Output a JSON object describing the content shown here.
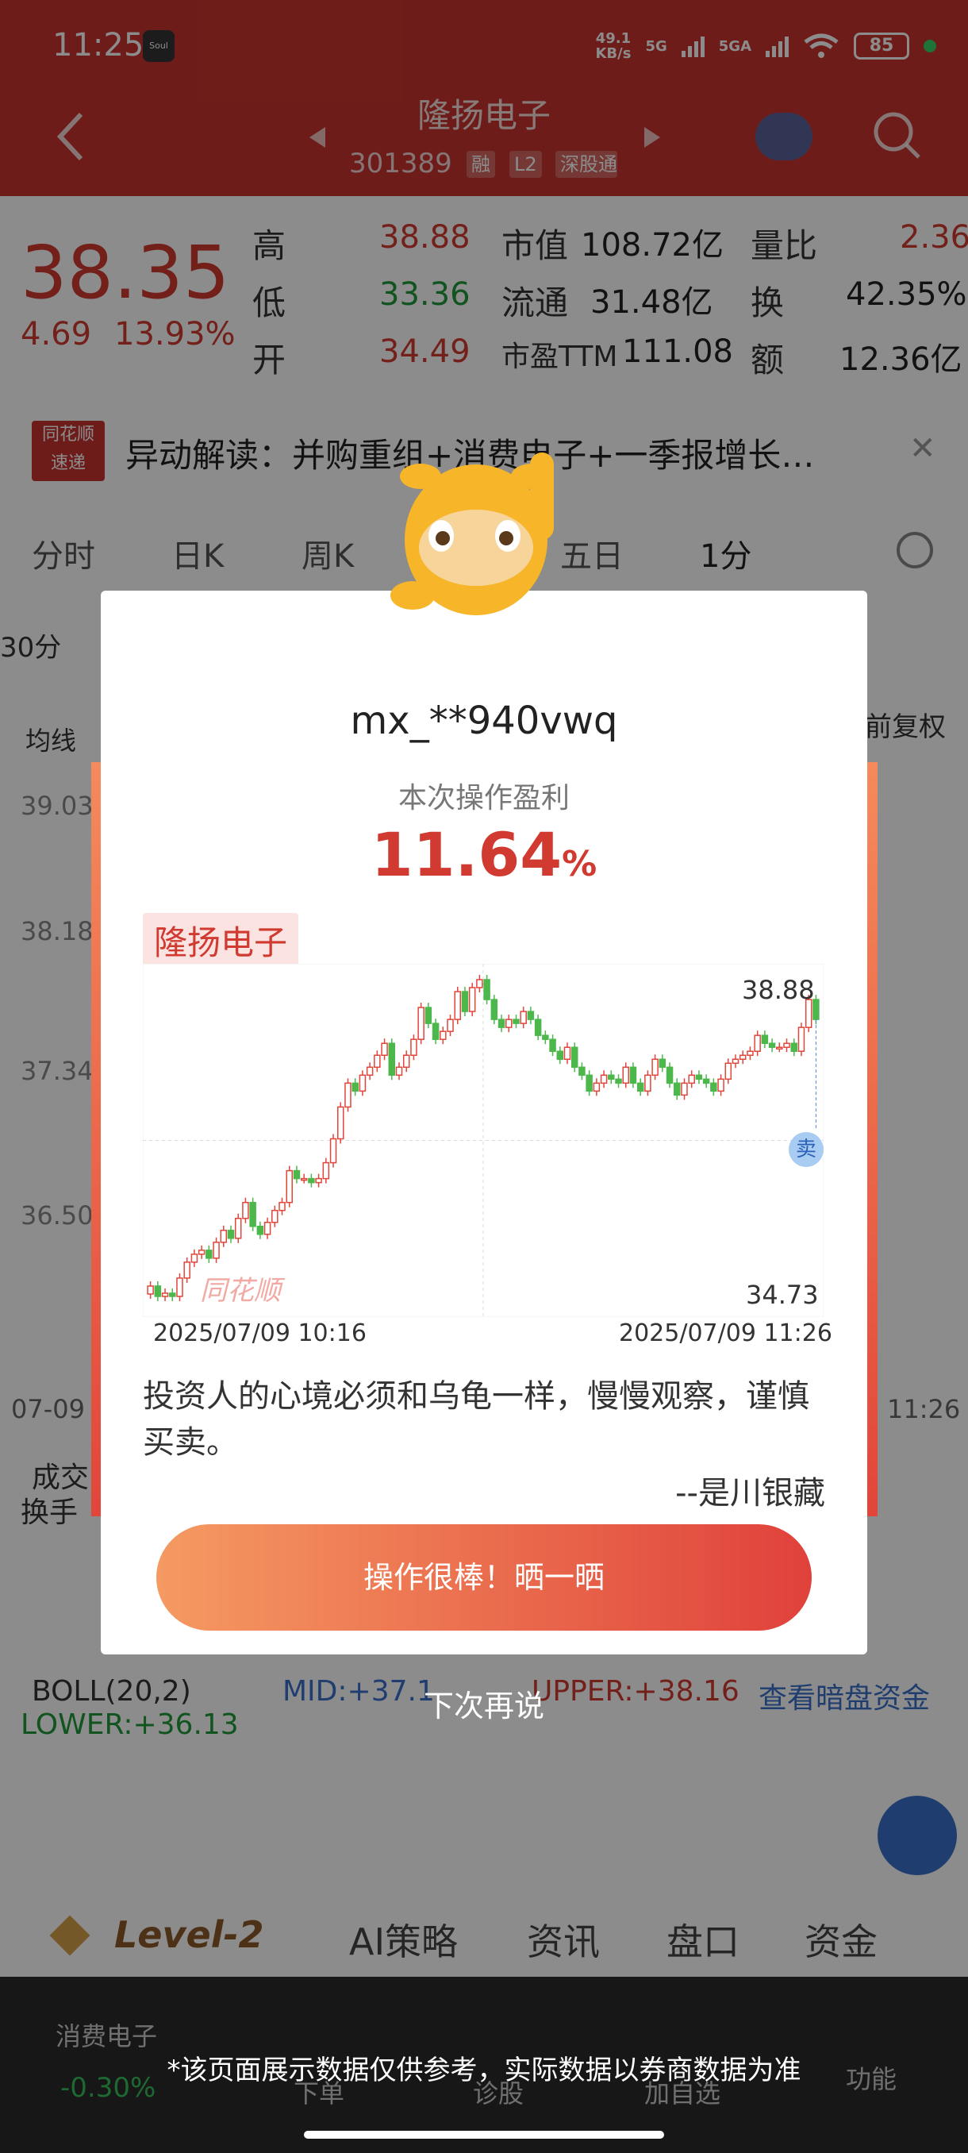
{
  "status_bar": {
    "time": "11:25",
    "app_icon": "Soul",
    "net_speed_top": "49.1",
    "net_speed_bottom": "KB/s",
    "sig1": "5G",
    "sig2": "5GA",
    "battery": "85"
  },
  "nav": {
    "title": "隆扬电子",
    "code": "301389",
    "tags": [
      "融",
      "L2",
      "深股通"
    ]
  },
  "quote": {
    "price": "38.35",
    "change": "4.69",
    "change_pct": "13.93%",
    "rows": [
      {
        "l1": "高",
        "v1": "38.88",
        "l2": "市值",
        "v2": "108.72亿",
        "l3": "量比",
        "v3": "2.36"
      },
      {
        "l1": "低",
        "v1": "33.36",
        "l2": "流通",
        "v2": "31.48亿",
        "l3": "换",
        "v3": "42.35%"
      },
      {
        "l1": "开",
        "v1": "34.49",
        "l2": "市盈TTM",
        "v2": "111.08",
        "l3": "额",
        "v3": "12.36亿"
      }
    ]
  },
  "news": {
    "brand_top": "同花顺",
    "brand_bottom": "速递",
    "text": "异动解读：并购重组+消费电子+一季报增长…"
  },
  "tabs": [
    "分时",
    "日K",
    "周K",
    "五日",
    "1分"
  ],
  "chart_labels": {
    "period": "30分",
    "ma": "均线",
    "adj": "前复权",
    "y1": "39.03",
    "y2": "38.18",
    "y3": "37.34",
    "y4": "36.50",
    "date_l": "07-09",
    "date_r": "11:26",
    "vol_label": "成交",
    "turn_label": "换手"
  },
  "indicator": {
    "name": "BOLL(20,2)",
    "mid": "MID:+37.1",
    "upper": "UPPER:+38.16",
    "lower": "LOWER:+36.13",
    "link": "查看暗盘资金"
  },
  "bottom_tabs": {
    "level2": "Level-2",
    "items": [
      "AI策略",
      "资讯",
      "盘口",
      "资金"
    ]
  },
  "footer": {
    "sector": "消费电子",
    "sector_chg": "-0.30%",
    "btns": [
      "下单",
      "诊股",
      "加自选",
      "功能"
    ]
  },
  "modal": {
    "username": "mx_**940vwq",
    "profit_label": "本次操作盈利",
    "profit_value": "11.64",
    "profit_unit": "%",
    "stock_name": "隆扬电子",
    "high_label": "38.88",
    "low_label": "34.73",
    "sell_label": "卖",
    "watermark": "同花顺",
    "start_time": "2025/07/09 10:16",
    "end_time": "2025/07/09 11:26",
    "quote": "投资人的心境必须和乌龟一样，慢慢观察，谨慎买卖。",
    "author": "--是川银藏",
    "share_button": "操作很棒！晒一晒",
    "dismiss": "下次再说"
  },
  "disclaimer": "*该页面展示数据仅供参考，实际数据以券商数据为准",
  "colors": {
    "up": "#d13a30",
    "down": "#1f9a3a",
    "brand": "#c8342e"
  },
  "chart_data": {
    "type": "candlestick",
    "title": "隆扬电子",
    "ylim": [
      34.73,
      38.88
    ],
    "x_range": [
      "2025/07/09 10:16",
      "2025/07/09 11:26"
    ],
    "closes": [
      34.95,
      34.82,
      34.86,
      34.82,
      35.05,
      35.25,
      35.35,
      35.4,
      35.3,
      35.5,
      35.65,
      35.55,
      35.8,
      36.0,
      35.7,
      35.6,
      35.75,
      35.9,
      36.0,
      36.4,
      36.3,
      36.3,
      36.25,
      36.3,
      36.5,
      36.8,
      37.2,
      37.5,
      37.4,
      37.6,
      37.7,
      37.85,
      38.0,
      37.6,
      37.7,
      37.85,
      38.05,
      38.45,
      38.25,
      38.05,
      38.15,
      38.3,
      38.65,
      38.4,
      38.7,
      38.8,
      38.55,
      38.3,
      38.2,
      38.3,
      38.25,
      38.4,
      38.3,
      38.1,
      38.05,
      37.9,
      37.8,
      37.95,
      37.7,
      37.6,
      37.4,
      37.5,
      37.6,
      37.55,
      37.5,
      37.7,
      37.5,
      37.4,
      37.6,
      37.8,
      37.7,
      37.5,
      37.35,
      37.5,
      37.6,
      37.55,
      37.5,
      37.4,
      37.55,
      37.75,
      37.8,
      37.85,
      37.9,
      38.1,
      38.0,
      37.95,
      37.95,
      38.0,
      37.9,
      38.2,
      38.55,
      38.3
    ]
  }
}
